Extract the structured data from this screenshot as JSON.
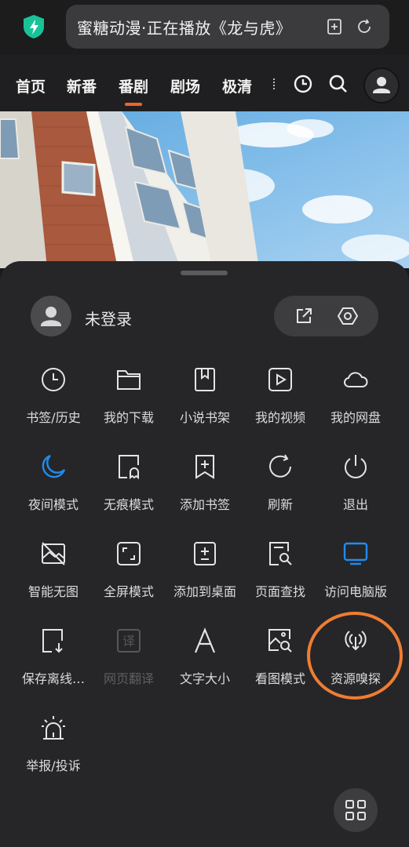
{
  "address_bar": {
    "title": "蜜糖动漫·正在播放《龙与虎》",
    "icons": [
      "shield-bolt-icon",
      "add-bookmark-icon",
      "refresh-icon"
    ]
  },
  "site_nav": {
    "tabs": [
      {
        "label": "首页",
        "active": false
      },
      {
        "label": "新番",
        "active": false
      },
      {
        "label": "番剧",
        "active": true
      },
      {
        "label": "剧场",
        "active": false
      },
      {
        "label": "极清",
        "active": false
      }
    ],
    "icons": [
      "history-clock-icon",
      "search-icon",
      "user-avatar-icon"
    ]
  },
  "sheet": {
    "login_label": "未登录",
    "pill_icons": [
      "share-icon",
      "settings-hex-icon"
    ],
    "items": [
      {
        "label": "书签/历史",
        "icon": "clock-icon"
      },
      {
        "label": "我的下载",
        "icon": "folder-icon"
      },
      {
        "label": "小说书架",
        "icon": "book-icon"
      },
      {
        "label": "我的视频",
        "icon": "video-play-icon"
      },
      {
        "label": "我的网盘",
        "icon": "cloud-icon"
      },
      {
        "label": "夜间模式",
        "icon": "moon-icon"
      },
      {
        "label": "无痕模式",
        "icon": "ghost-page-icon"
      },
      {
        "label": "添加书签",
        "icon": "bookmark-add-icon"
      },
      {
        "label": "刷新",
        "icon": "refresh-icon"
      },
      {
        "label": "退出",
        "icon": "power-icon"
      },
      {
        "label": "智能无图",
        "icon": "no-image-icon"
      },
      {
        "label": "全屏模式",
        "icon": "fullscreen-icon"
      },
      {
        "label": "添加到桌面",
        "icon": "add-to-desktop-icon"
      },
      {
        "label": "页面查找",
        "icon": "page-search-icon"
      },
      {
        "label": "访问电脑版",
        "icon": "monitor-icon"
      },
      {
        "label": "保存离线…",
        "icon": "save-offline-icon"
      },
      {
        "label": "网页翻译",
        "icon": "translate-icon",
        "disabled": true
      },
      {
        "label": "文字大小",
        "icon": "font-size-icon"
      },
      {
        "label": "看图模式",
        "icon": "image-search-icon"
      },
      {
        "label": "资源嗅探",
        "icon": "signal-sniff-icon"
      },
      {
        "label": "举报/投诉",
        "icon": "alarm-report-icon"
      }
    ],
    "bottom_icon": "apps-grid-icon"
  },
  "colors": {
    "accent_blue": "#1f8cf0",
    "tab_underline": "#f26522",
    "annotation_circle": "#ef7d33",
    "shield_green": "#19c39a"
  }
}
